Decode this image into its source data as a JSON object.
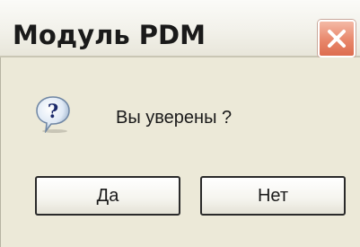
{
  "window": {
    "title": "Модуль PDM"
  },
  "dialog": {
    "message": "Вы уверены ?",
    "icon": "question-icon"
  },
  "buttons": {
    "yes_label": "Да",
    "no_label": "Нет"
  },
  "colors": {
    "close_button": "#e8876b",
    "dialog_background": "#ece9d8",
    "titlebar": "#f2f1ea"
  }
}
